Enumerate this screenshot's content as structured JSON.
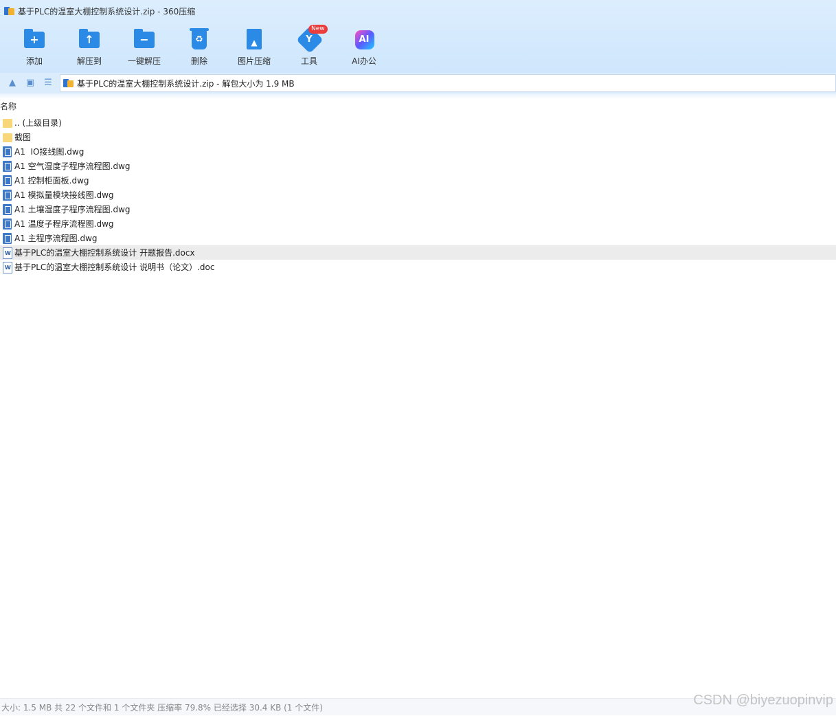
{
  "window": {
    "title": "基于PLC的温室大棚控制系统设计.zip - 360压缩"
  },
  "toolbar": {
    "items": [
      {
        "label": "添加",
        "icon": "add-folder-icon"
      },
      {
        "label": "解压到",
        "icon": "extract-to-icon"
      },
      {
        "label": "一键解压",
        "icon": "one-click-extract-icon"
      },
      {
        "label": "删除",
        "icon": "delete-icon"
      },
      {
        "label": "图片压缩",
        "icon": "image-compress-icon"
      },
      {
        "label": "工具",
        "icon": "tools-icon",
        "badge": "New"
      },
      {
        "label": "AI办公",
        "icon": "ai-office-icon",
        "icon_text": "AI"
      }
    ]
  },
  "address": {
    "text": "基于PLC的温室大棚控制系统设计.zip - 解包大小为 1.9 MB"
  },
  "list": {
    "column_name": "名称",
    "rows": [
      {
        "name": ".. (上级目录)",
        "type": "folder"
      },
      {
        "name": "截图",
        "type": "folder"
      },
      {
        "name": "A1  IO接线图.dwg",
        "type": "dwg"
      },
      {
        "name": "A1 空气湿度子程序流程图.dwg",
        "type": "dwg"
      },
      {
        "name": "A1 控制柜面板.dwg",
        "type": "dwg"
      },
      {
        "name": "A1 模拟量模块接线图.dwg",
        "type": "dwg"
      },
      {
        "name": "A1 土壤湿度子程序流程图.dwg",
        "type": "dwg"
      },
      {
        "name": "A1 温度子程序流程图.dwg",
        "type": "dwg"
      },
      {
        "name": "A1 主程序流程图.dwg",
        "type": "dwg"
      },
      {
        "name": "基于PLC的温室大棚控制系统设计 开题报告.docx",
        "type": "doc",
        "selected": true
      },
      {
        "name": "基于PLC的温室大棚控制系统设计 说明书（论文）.doc",
        "type": "doc"
      }
    ]
  },
  "status": {
    "text": "大小: 1.5 MB 共 22 个文件和 1 个文件夹 压缩率 79.8% 已经选择 30.4 KB (1 个文件)"
  },
  "watermark": "CSDN @biyezuopinvip",
  "colors": {
    "toolbar_bg": "#d6eafd",
    "accent": "#2a8ae6",
    "selected_row": "#ececec"
  }
}
